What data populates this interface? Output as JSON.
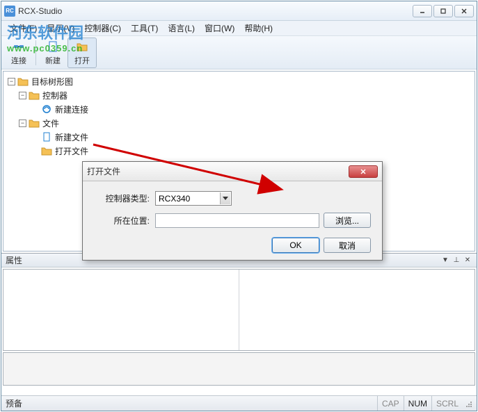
{
  "app": {
    "title": "RCX-Studio",
    "icon_text": "RC"
  },
  "watermark": {
    "text": "河东软件园",
    "url": "www.pc0359.cn"
  },
  "menu": {
    "file": "文件(F)",
    "view": "显示(V)",
    "controller": "控制器(C)",
    "tools": "工具(T)",
    "language": "语言(L)",
    "window": "窗口(W)",
    "help": "帮助(H)"
  },
  "toolbar": {
    "connect": "连接",
    "new": "新建",
    "open": "打开"
  },
  "tree": {
    "root": "目标树形图",
    "controller": "控制器",
    "new_connection": "新建连接",
    "files": "文件",
    "new_file": "新建文件",
    "open_file": "打开文件"
  },
  "dialog": {
    "title": "打开文件",
    "controller_type_label": "控制器类型:",
    "controller_type_value": "RCX340",
    "location_label": "所在位置:",
    "location_value": "",
    "browse": "浏览...",
    "ok": "OK",
    "cancel": "取消"
  },
  "props": {
    "title": "属性"
  },
  "status": {
    "ready": "预备",
    "cap": "CAP",
    "num": "NUM",
    "scrl": "SCRL"
  }
}
